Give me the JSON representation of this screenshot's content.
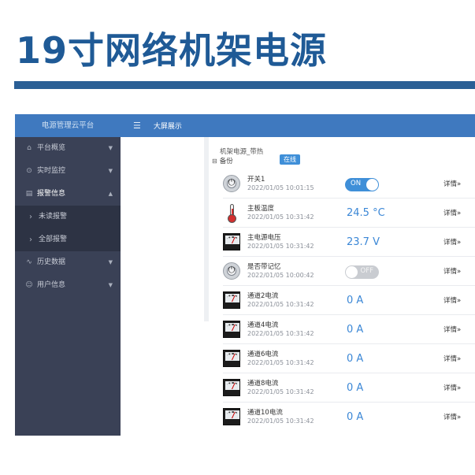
{
  "banner": {
    "title": "19寸网络机架电源"
  },
  "sidebar": {
    "brand": "电源管理云平台",
    "items": [
      {
        "label": "平台概览",
        "icon": "home-icon",
        "glyph": "⌂",
        "caret": "▼"
      },
      {
        "label": "实时监控",
        "icon": "monitor-icon",
        "glyph": "⊙",
        "caret": "▼"
      },
      {
        "label": "报警信息",
        "icon": "alarm-icon",
        "glyph": "▤",
        "caret": "▲"
      }
    ],
    "submenu": [
      {
        "label": "未读报警",
        "glyph": "›"
      },
      {
        "label": "全部报警",
        "glyph": "›"
      }
    ],
    "items_after": [
      {
        "label": "历史数据",
        "icon": "history-icon",
        "glyph": "∿",
        "caret": "▼"
      },
      {
        "label": "用户信息",
        "icon": "user-icon",
        "glyph": "☺",
        "caret": "▼"
      }
    ]
  },
  "topbar": {
    "menu_glyph": "☰",
    "title": "大屏展示"
  },
  "device": {
    "name": "机架电源_带热",
    "backup_glyph": "⊟",
    "backup": "备份",
    "status": "在线"
  },
  "rows": [
    {
      "name": "开关1",
      "time": "2022/01/05 10:01:15",
      "type": "switch",
      "state": "ON",
      "detail": "详情»"
    },
    {
      "name": "主板温度",
      "time": "2022/01/05 10:31:42",
      "type": "thermo",
      "value": "24.5 °C",
      "detail": "详情»"
    },
    {
      "name": "主电源电压",
      "time": "2022/01/05 10:31:42",
      "type": "meter",
      "value": "23.7 V",
      "detail": "详情»"
    },
    {
      "name": "是否带记忆",
      "time": "2022/01/05 10:00:42",
      "type": "switch",
      "state": "OFF",
      "detail": "详情»"
    },
    {
      "name": "通道2电流",
      "time": "2022/01/05 10:31:42",
      "type": "meter",
      "value": "0 A",
      "detail": "详情»"
    },
    {
      "name": "通道4电流",
      "time": "2022/01/05 10:31:42",
      "type": "meter",
      "value": "0 A",
      "detail": "详情»"
    },
    {
      "name": "通道6电流",
      "time": "2022/01/05 10:31:42",
      "type": "meter",
      "value": "0 A",
      "detail": "详情»"
    },
    {
      "name": "通道8电流",
      "time": "2022/01/05 10:31:42",
      "type": "meter",
      "value": "0 A",
      "detail": "详情»"
    },
    {
      "name": "通道10电流",
      "time": "2022/01/05 10:31:42",
      "type": "meter",
      "value": "0 A",
      "detail": "详情»"
    }
  ],
  "colors": {
    "brand_blue": "#3f79bf",
    "sidebar_bg": "#3a4156",
    "value_blue": "#3b87d6",
    "banner_title": "#1f5a96"
  }
}
